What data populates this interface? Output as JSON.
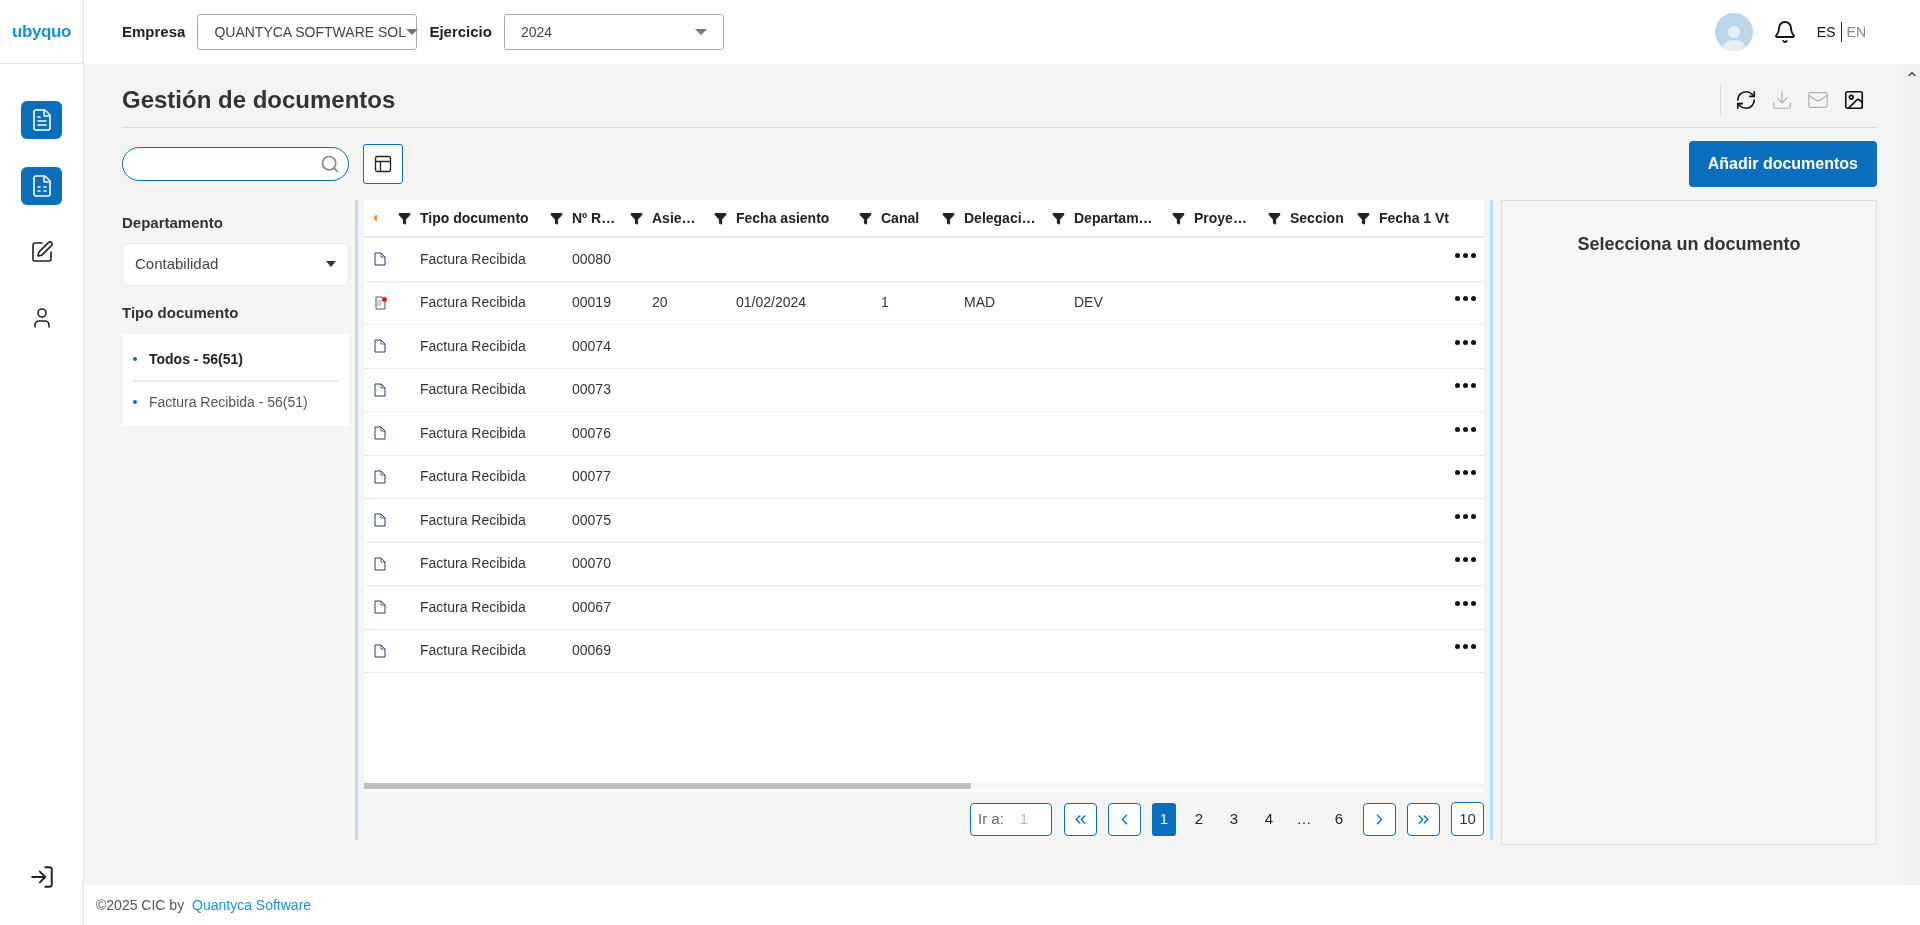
{
  "header": {
    "logo": "ubyquo",
    "company_label": "Empresa",
    "company_value": "QUANTYCA SOFTWARE SOL",
    "year_label": "Ejercicio",
    "year_value": "2024",
    "languages": [
      {
        "label": "ES",
        "selected": true
      },
      {
        "label": "EN",
        "selected": false
      }
    ]
  },
  "nav": [
    {
      "kind": "document",
      "selected": true
    },
    {
      "kind": "spreadsheet",
      "selected": true
    },
    {
      "kind": "edit",
      "selected": false
    },
    {
      "kind": "user",
      "selected": false
    }
  ],
  "page_title": "Gestión de documentos",
  "actions": [
    {
      "kind": "refresh",
      "disabled": false
    },
    {
      "kind": "download",
      "disabled": true
    },
    {
      "kind": "mail",
      "disabled": true
    },
    {
      "kind": "image",
      "disabled": false
    }
  ],
  "add_button": "Añadir documentos",
  "filters": {
    "department_label": "Departamento",
    "department_value": "Contabilidad",
    "type_label": "Tipo documento",
    "types": [
      {
        "label": "Todos - 56(51)",
        "selected": true
      },
      {
        "label": "Factura Recibida - 56(51)",
        "selected": false
      }
    ]
  },
  "table": {
    "columns": [
      "Tipo documento",
      "Nº R…",
      "Asie…",
      "Fecha asiento",
      "Canal",
      "Delegaci…",
      "Departam…",
      "Proye…",
      "Seccion",
      "Fecha 1 Vt"
    ],
    "rows": [
      {
        "kind": "plain",
        "cells": [
          "Factura Recibida",
          "00080"
        ]
      },
      {
        "kind": "flagged",
        "cells": [
          "Factura Recibida",
          "00019",
          "20",
          "01/02/2024",
          "1",
          "MAD",
          "DEV"
        ]
      },
      {
        "kind": "plain",
        "cells": [
          "Factura Recibida",
          "00074"
        ]
      },
      {
        "kind": "plain",
        "cells": [
          "Factura Recibida",
          "00073"
        ]
      },
      {
        "kind": "plain",
        "cells": [
          "Factura Recibida",
          "00076"
        ]
      },
      {
        "kind": "plain",
        "cells": [
          "Factura Recibida",
          "00077"
        ]
      },
      {
        "kind": "plain",
        "cells": [
          "Factura Recibida",
          "00075"
        ]
      },
      {
        "kind": "plain",
        "cells": [
          "Factura Recibida",
          "00070"
        ]
      },
      {
        "kind": "plain",
        "cells": [
          "Factura Recibida",
          "00067"
        ]
      },
      {
        "kind": "plain",
        "cells": [
          "Factura Recibida",
          "00069"
        ]
      }
    ]
  },
  "pagination": {
    "goto_label": "Ir a:",
    "goto_placeholder": "1",
    "pages": [
      {
        "label": "1",
        "selected": true
      },
      {
        "label": "2",
        "selected": false
      },
      {
        "label": "3",
        "selected": false
      },
      {
        "label": "4",
        "selected": false
      }
    ],
    "gap": "…",
    "last_pages": [
      {
        "label": "6",
        "selected": false
      }
    ],
    "page_size": "10"
  },
  "detail_panel": {
    "message": "Selecciona un documento"
  },
  "footer": {
    "text": "©2025 CIC by ",
    "link": "Quantyca Software"
  }
}
